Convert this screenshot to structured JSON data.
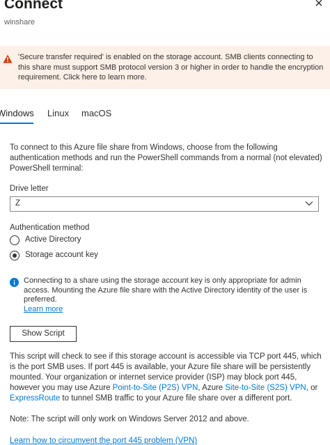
{
  "header": {
    "title": "Connect",
    "subtitle": "winshare",
    "close_symbol": "×",
    "close_icon": "close-icon"
  },
  "warning": {
    "icon": "warning-icon",
    "color": "#d83b01",
    "background": "#fdf0e8",
    "text": "'Secure transfer required' is enabled on the storage account. SMB clients connecting to this share must support SMB protocol version 3 or higher in order to handle the encryption requirement. Click here to learn more."
  },
  "tabs": [
    {
      "label": "Windows",
      "selected": true
    },
    {
      "label": "Linux",
      "selected": false
    },
    {
      "label": "macOS",
      "selected": false
    }
  ],
  "intro_text": "To connect to this Azure file share from Windows, choose from the following authentication methods and run the PowerShell commands from a normal (not elevated) PowerShell terminal:",
  "drive_letter": {
    "label": "Drive letter",
    "value": "Z",
    "icon": "chevron-down-icon"
  },
  "auth": {
    "label": "Authentication method",
    "options": [
      {
        "label": "Active Directory",
        "selected": false
      },
      {
        "label": "Storage account key",
        "selected": true
      }
    ]
  },
  "info": {
    "icon": "info-icon",
    "color": "#0078d4",
    "text": "Connecting to a share using the storage account key is only appropriate for admin access. Mounting the Azure file share with the Active Directory identity of the user is preferred.",
    "link": "Learn more"
  },
  "show_script_label": "Show Script",
  "script_text": {
    "part1": "This script will check to see if this storage account is accessible via TCP port 445, which is the port SMB uses. If port 445 is available, your Azure file share will be persistently mounted. Your organization or internet service provider (ISP) may block port 445, however you may use Azure ",
    "link1": "Point-to-Site (P2S) VPN",
    "part2": ", Azure ",
    "link2": "Site-to-Site (S2S) VPN",
    "part3": ", or ",
    "link3": "ExpressRoute",
    "part4": " to tunnel SMB traffic to your Azure file share over a different port."
  },
  "note": "Note: The script will only work on Windows Server 2012 and above.",
  "bottom_link": "Learn how to circumvent the port 445 problem (VPN)",
  "colors": {
    "accent": "#0078d4",
    "text": "#323130"
  }
}
